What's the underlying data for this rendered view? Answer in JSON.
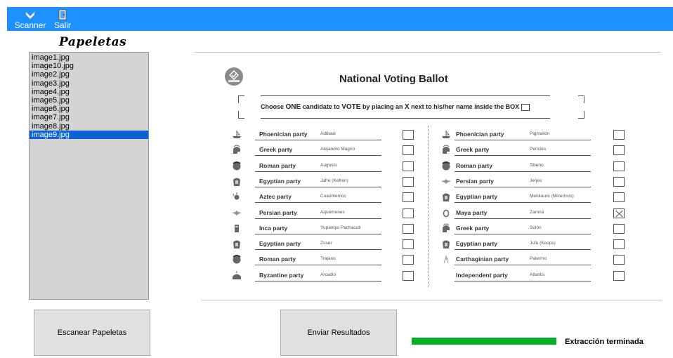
{
  "toolbar": {
    "scanner_label": "Scanner",
    "salir_label": "Salir",
    "bg_color": "#1e90ff"
  },
  "sidebar": {
    "title": "Papeletas",
    "files": [
      "image1.jpg",
      "image10.jpg",
      "image2.jpg",
      "image3.jpg",
      "image4.jpg",
      "image5.jpg",
      "image6.jpg",
      "image7.jpg",
      "image8.jpg",
      "image9.jpg"
    ],
    "selected_file": "image9.jpg"
  },
  "ballot": {
    "title": "National Voting Ballot",
    "instruction_pre": "Choose ",
    "instruction_one": "ONE",
    "instruction_mid": " candidate to ",
    "instruction_vote": "VOTE",
    "instruction_mid2": " by placing an ",
    "instruction_x": "X",
    "instruction_post": " next to his/her name inside the BOX",
    "left": [
      {
        "party": "Phoenician party",
        "candidate": "Adibaal",
        "icon": "ship-icon",
        "checked": false
      },
      {
        "party": "Greek party",
        "candidate": "Alejandro Magno",
        "icon": "greek-helmet-icon",
        "checked": false
      },
      {
        "party": "Roman party",
        "candidate": "Augusto",
        "icon": "roman-helmet-icon",
        "checked": false
      },
      {
        "party": "Egyptian party",
        "candidate": "Jafre (Kefren)",
        "icon": "pharaoh-icon",
        "checked": false
      },
      {
        "party": "Aztec party",
        "candidate": "Cuauhtemoc",
        "icon": "aztec-head-icon",
        "checked": false
      },
      {
        "party": "Persian party",
        "candidate": "Aquemenes",
        "icon": "faravahar-icon",
        "checked": false
      },
      {
        "party": "Inca party",
        "candidate": "Yupanqui Pachacuti",
        "icon": "inca-statue-icon",
        "checked": false
      },
      {
        "party": "Egyptian party",
        "candidate": "Zoser",
        "icon": "pharaoh-icon",
        "checked": false
      },
      {
        "party": "Roman party",
        "candidate": "Trajano",
        "icon": "roman-helmet-icon",
        "checked": false
      },
      {
        "party": "Byzantine  party",
        "candidate": "Arcadio",
        "icon": "byzantine-dome-icon",
        "checked": false
      }
    ],
    "right": [
      {
        "party": "Phoenician party",
        "candidate": "Pigmalión",
        "icon": "ship-icon",
        "checked": false
      },
      {
        "party": "Greek party",
        "candidate": "Pericles",
        "icon": "greek-helmet-icon",
        "checked": false
      },
      {
        "party": "Roman party",
        "candidate": "Tiberio",
        "icon": "roman-helmet-icon",
        "checked": false
      },
      {
        "party": "Persian party",
        "candidate": "Jerjes",
        "icon": "faravahar-icon",
        "checked": false
      },
      {
        "party": "Egyptian party",
        "candidate": "Menkaure (Micerinos)",
        "icon": "pharaoh-icon",
        "checked": false
      },
      {
        "party": "Maya party",
        "candidate": "Zamná",
        "icon": "maya-head-icon",
        "checked": true
      },
      {
        "party": "Greek party",
        "candidate": "Solón",
        "icon": "greek-helmet-icon",
        "checked": false
      },
      {
        "party": "Egyptian party",
        "candidate": "Jufu (Keops)",
        "icon": "pharaoh-icon",
        "checked": false
      },
      {
        "party": "Carthaginian party",
        "candidate": "Palermo",
        "icon": "carthaginian-figure-icon",
        "checked": false
      },
      {
        "party": "Independent  party",
        "candidate": "Atlantis",
        "icon": "",
        "checked": false
      }
    ]
  },
  "actions": {
    "scan_label": "Escanear Papeletas",
    "send_label": "Enviar Resultados"
  },
  "progress": {
    "fraction": 1.0,
    "color": "#06b025",
    "status_text": "Extracción terminada"
  }
}
